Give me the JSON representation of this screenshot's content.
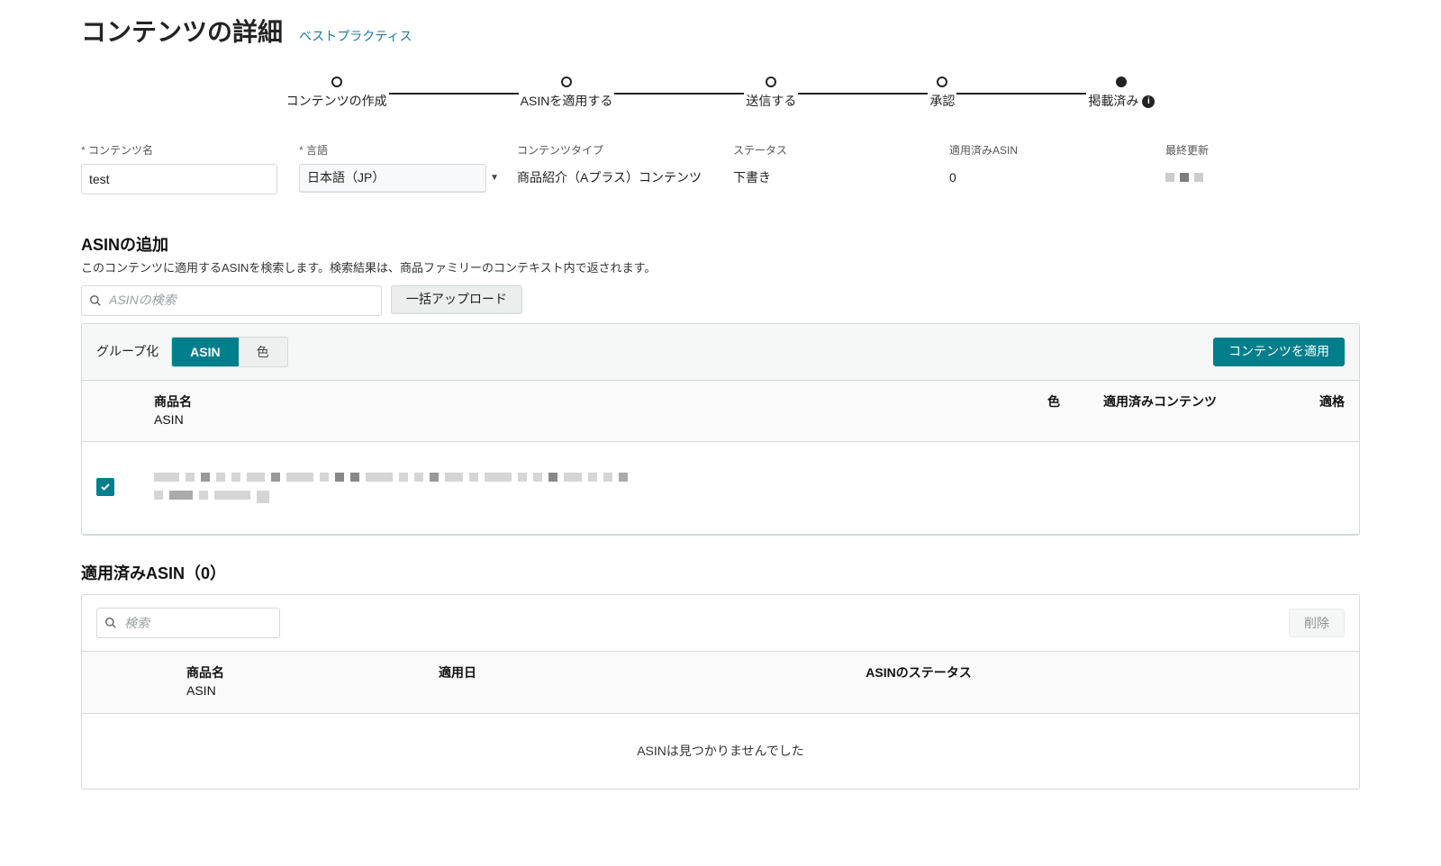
{
  "header": {
    "title": "コンテンツの詳細",
    "help_link": "ベストプラクティス"
  },
  "stepper": {
    "steps": [
      {
        "label": "コンテンツの作成"
      },
      {
        "label": "ASINを適用する"
      },
      {
        "label": "送信する"
      },
      {
        "label": "承認"
      },
      {
        "label": "掲載済み",
        "info": true,
        "filled": true
      }
    ]
  },
  "meta": {
    "name_label": "コンテンツ名",
    "name_value": "test",
    "lang_label": "言語",
    "lang_value": "日本語（JP）",
    "type_label": "コンテンツタイプ",
    "type_value": "商品紹介（Aプラス）コンテンツ",
    "status_label": "ステータス",
    "status_value": "下書き",
    "applied_label": "適用済みASIN",
    "applied_value": "0",
    "updated_label": "最終更新"
  },
  "add_asin": {
    "title": "ASINの追加",
    "subtitle": "このコンテンツに適用するASINを検索します。検索結果は、商品ファミリーのコンテキスト内で返されます。",
    "search_placeholder": "ASINの検索",
    "bulk_button": "一括アップロード",
    "group_by_label": "グループ化",
    "group_asin": "ASIN",
    "group_color": "色",
    "apply_button": "コンテンツを適用",
    "columns": {
      "name": "商品名",
      "name_sub": "ASIN",
      "color": "色",
      "applied": "適用済みコンテンツ",
      "eligible": "適格"
    }
  },
  "applied": {
    "title": "適用済みASIN（0）",
    "search_placeholder": "検索",
    "delete_button": "削除",
    "columns": {
      "name": "商品名",
      "name_sub": "ASIN",
      "date": "適用日",
      "status": "ASINのステータス"
    },
    "empty_text": "ASINは見つかりませんでした"
  }
}
